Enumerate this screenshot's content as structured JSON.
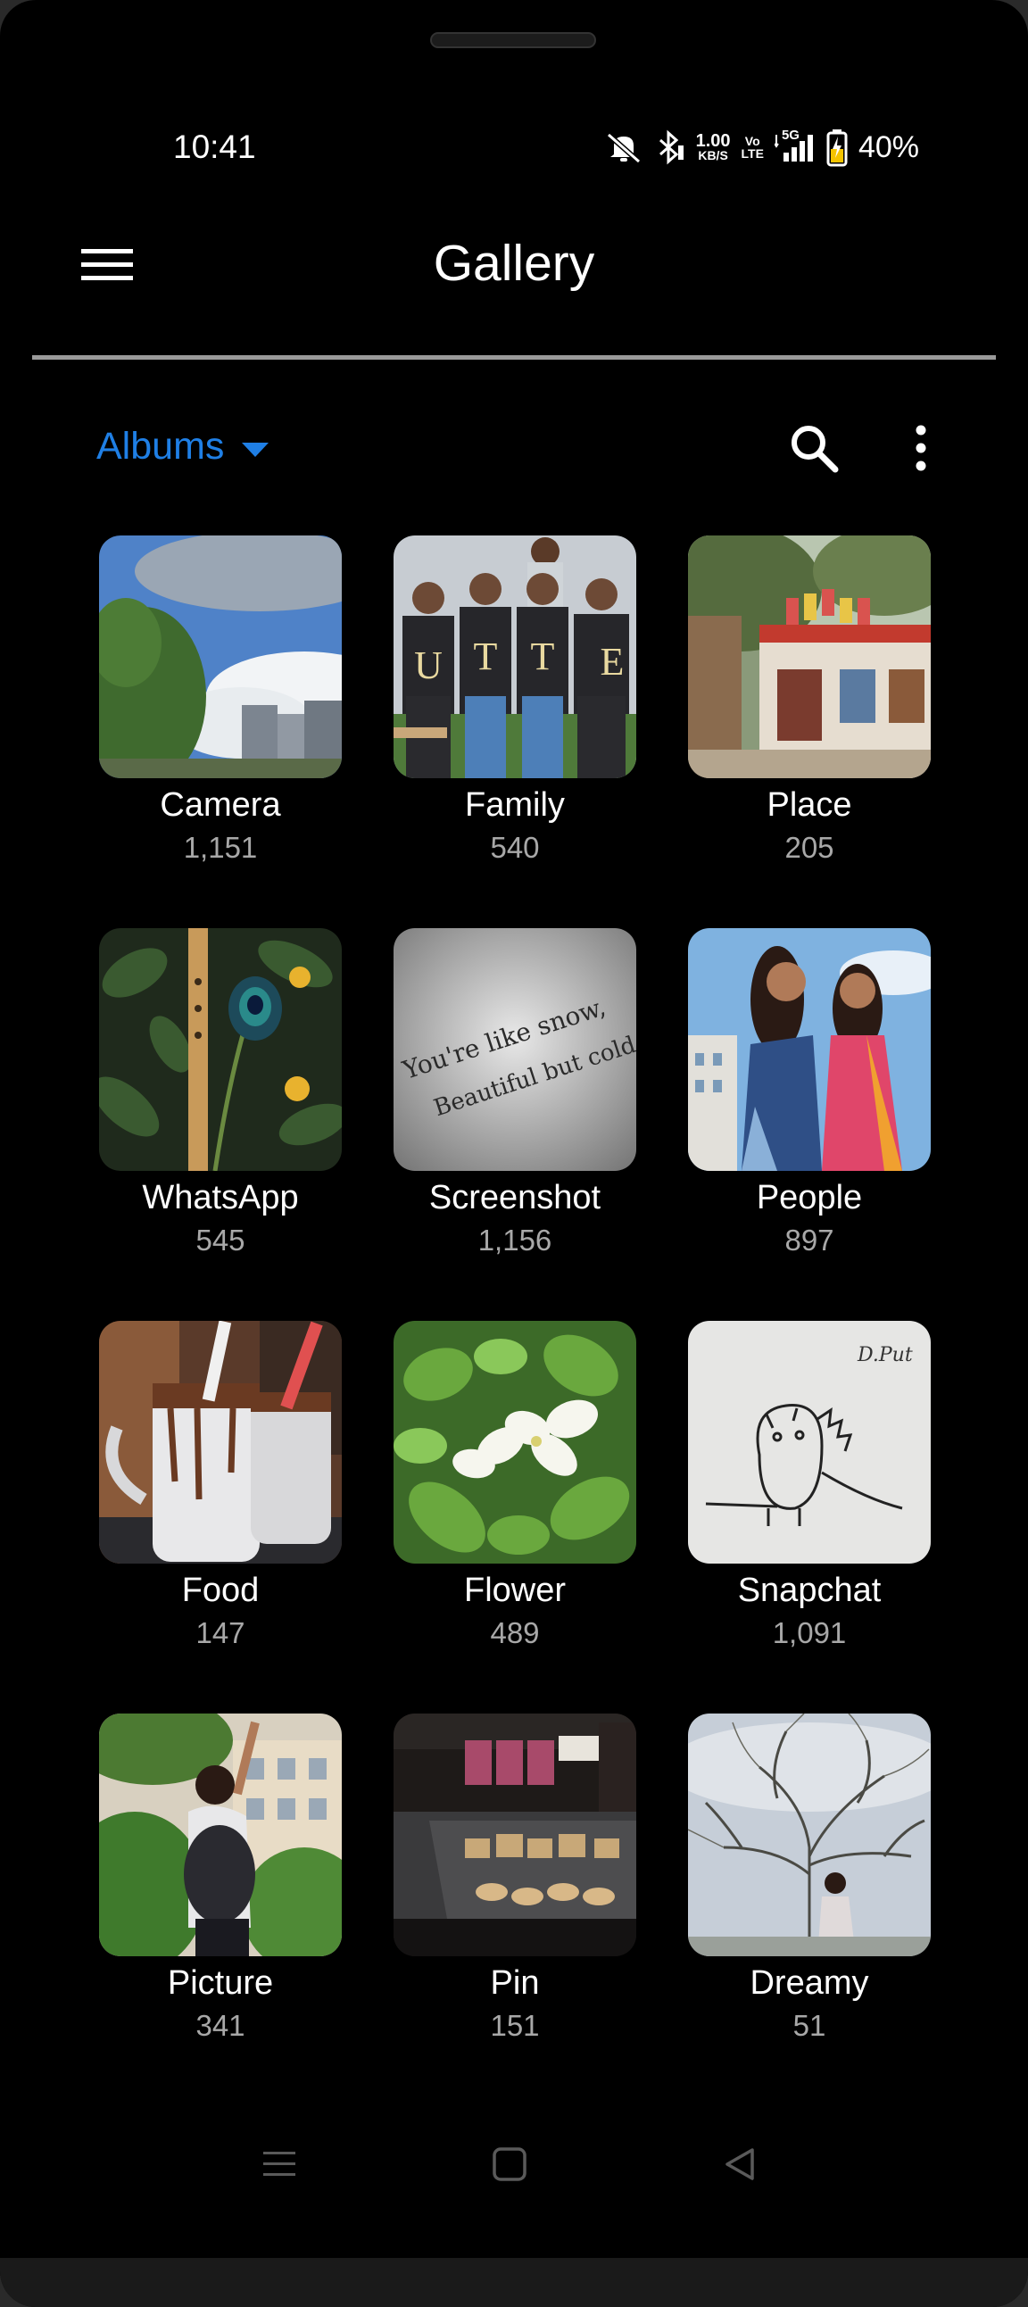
{
  "status_bar": {
    "time": "10:41",
    "net_speed_value": "1.00",
    "net_speed_unit": "KB/S",
    "volte_label_top": "Vo",
    "volte_label_bottom": "LTE",
    "network_type": "5G",
    "battery_percent": "40%"
  },
  "app_bar": {
    "title": "Gallery",
    "menu_icon": "hamburger-menu-icon"
  },
  "toolbar": {
    "view_selector_label": "Albums",
    "view_selector_icon": "caret-down-icon",
    "search_icon": "search-icon",
    "more_icon": "more-vertical-icon",
    "accent_color": "#1f7fe5"
  },
  "albums": [
    {
      "name": "Camera",
      "count": "1,151"
    },
    {
      "name": "Family",
      "count": "540"
    },
    {
      "name": "Place",
      "count": "205"
    },
    {
      "name": "WhatsApp",
      "count": "545"
    },
    {
      "name": "Screenshot",
      "count": "1,156"
    },
    {
      "name": "People",
      "count": "897"
    },
    {
      "name": "Food",
      "count": "147"
    },
    {
      "name": "Flower",
      "count": "489"
    },
    {
      "name": "Snapchat",
      "count": "1,091"
    },
    {
      "name": "Picture",
      "count": "341"
    },
    {
      "name": "Pin",
      "count": "151"
    },
    {
      "name": "Dreamy",
      "count": "51"
    }
  ],
  "thumb_text": {
    "family_shirt_letters": [
      "U",
      "T",
      "T",
      "E"
    ],
    "screenshot_line1": "You're like snow,",
    "screenshot_line2": "Beautiful but cold.|",
    "snapchat_scribble": "D.Put"
  },
  "nav_bar": {
    "recents_icon": "recents-icon",
    "home_icon": "home-icon",
    "back_icon": "back-icon"
  }
}
